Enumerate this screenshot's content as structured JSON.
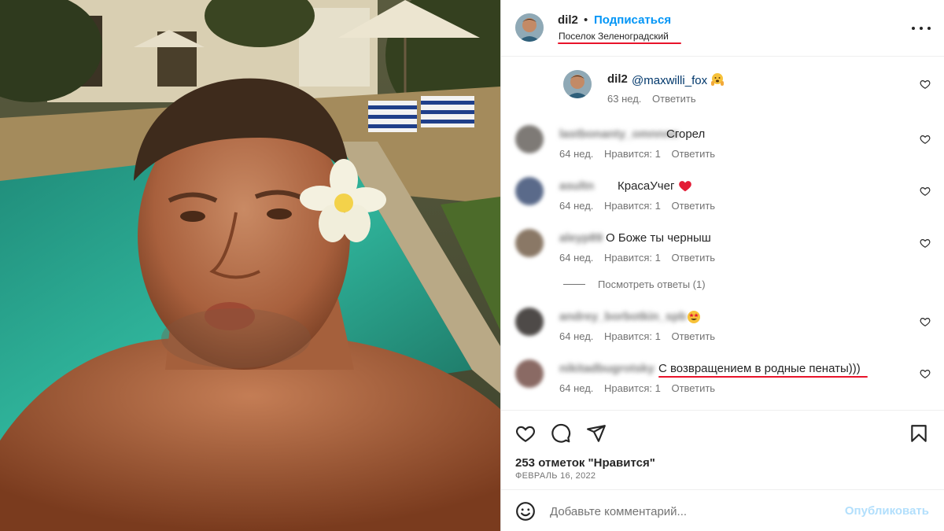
{
  "photo": {
    "alt_icon": "selfie-photo"
  },
  "header": {
    "username": "dil2",
    "separator": "•",
    "follow_label": "Подписаться",
    "location": "Поселок Зеленоградский",
    "more_icon": "more-horizontal-icon"
  },
  "comments": [
    {
      "username": "dil2",
      "mention": "@maxwilli_fox",
      "emoji": "face-with-open-hands",
      "meta_time": "63 нед.",
      "meta_likes": "",
      "meta_reply": "Ответить"
    },
    {
      "username": "lastbonanty_omnnnn",
      "text": "Сгорел",
      "meta_time": "64 нед.",
      "meta_likes": "Нравится: 1",
      "meta_reply": "Ответить"
    },
    {
      "username": "asultn",
      "text": "КрасаУчег",
      "emoji": "red-heart",
      "meta_time": "64 нед.",
      "meta_likes": "Нравится: 1",
      "meta_reply": "Ответить"
    },
    {
      "username": "aleyp89",
      "text": "О Боже ты черныш",
      "meta_time": "64 нед.",
      "meta_likes": "Нравится: 1",
      "meta_reply": "Ответить"
    },
    {
      "username": "andrey_borbotkin_spb",
      "text": "",
      "emoji": "star-struck",
      "meta_time": "64 нед.",
      "meta_likes": "Нравится: 1",
      "meta_reply": "Ответить"
    },
    {
      "username": "nikitadbugrotsky",
      "text": "С возвращением в родные пенаты)))",
      "meta_time": "64 нед.",
      "meta_likes": "Нравится: 1",
      "meta_reply": "Ответить"
    }
  ],
  "view_replies": "Посмотреть ответы (1)",
  "actions": {
    "likes": "253 отметок \"Нравится\"",
    "date": "ФЕВРАЛЬ 16, 2022"
  },
  "add_comment": {
    "placeholder": "Добавьте комментарий...",
    "publish_label": "Опубликовать"
  },
  "colors": {
    "accent": "#0095f6",
    "publish_disabled": "#b2dffc",
    "underline": "#e8132a",
    "muted": "#737373"
  }
}
